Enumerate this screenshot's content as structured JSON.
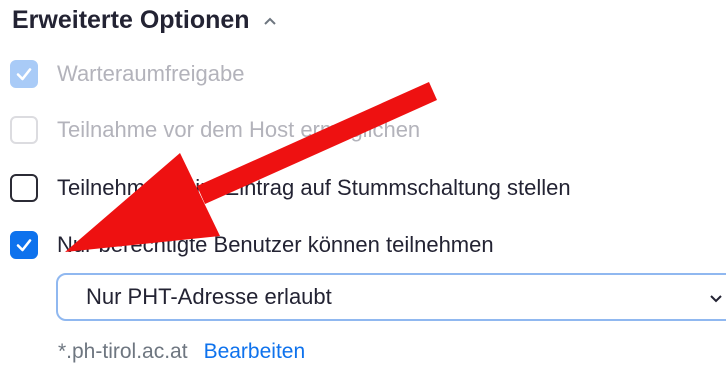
{
  "section": {
    "title": "Erweiterte Optionen",
    "toggle_icon": "chevron-up-icon"
  },
  "options": [
    {
      "label": "Warteraumfreigabe",
      "checked": true,
      "disabled": true
    },
    {
      "label": "Teilnahme vor dem Host ermöglichen",
      "checked": false,
      "disabled": true
    },
    {
      "label": "Teilnehmer beim Eintrag auf Stummschaltung stellen",
      "checked": false,
      "disabled": false
    },
    {
      "label": "Nur berechtigte Benutzer können teilnehmen",
      "checked": true,
      "disabled": false
    }
  ],
  "auth_select": {
    "value": "Nur PHT-Adresse erlaubt",
    "icon": "chevron-down-icon"
  },
  "domain": {
    "text": "*.ph-tirol.ac.at",
    "edit_label": "Bearbeiten"
  },
  "colors": {
    "accent": "#0e72ed",
    "accent_disabled": "#a9cbf7",
    "annotation_arrow": "#ee1111"
  }
}
